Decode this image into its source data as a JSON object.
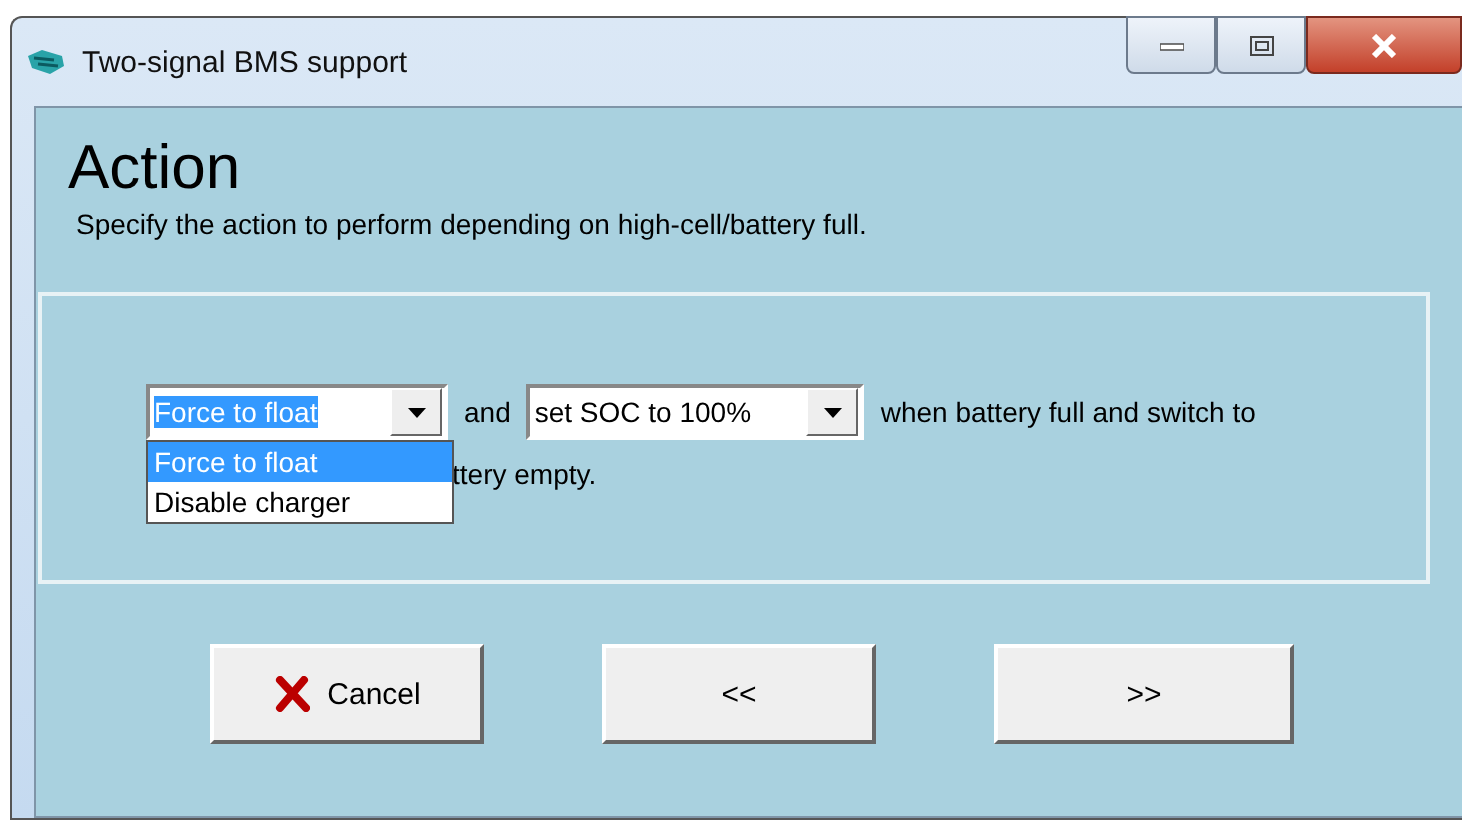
{
  "window": {
    "title": "Two-signal BMS support"
  },
  "heading": "Action",
  "description": "Specify the action to perform depending on high-cell/battery full.",
  "action_combo": {
    "value": "Force to float",
    "expanded": true,
    "options": [
      {
        "label": "Force to float",
        "selected": true
      },
      {
        "label": "Disable charger",
        "selected": false
      }
    ]
  },
  "joiner": "and",
  "soc_combo": {
    "value": "set SOC to 100%"
  },
  "sentence_tail": "when battery full and switch to",
  "second_line": "ttery empty.",
  "buttons": [
    {
      "label": "Cancel",
      "kind": "cancel"
    },
    {
      "label": "<<",
      "kind": "plain"
    },
    {
      "label": ">>",
      "kind": "plain"
    }
  ]
}
